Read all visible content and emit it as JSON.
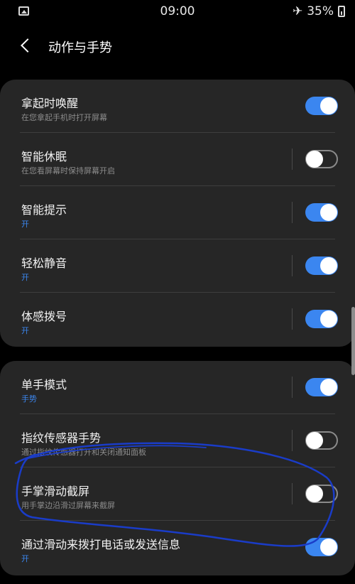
{
  "status_bar": {
    "time": "09:00",
    "battery": "35%",
    "icons": [
      "gallery-icon",
      "airplane-icon",
      "battery-icon"
    ]
  },
  "header": {
    "title": "动作与手势",
    "back_icon": "chevron-left-icon"
  },
  "sections": [
    {
      "items": [
        {
          "title": "拿起时唤醒",
          "subtitle": "在您拿起手机时打开屏幕",
          "toggle": "on"
        },
        {
          "title": "智能休眠",
          "subtitle": "在您看屏幕时保持屏幕开启",
          "toggle": "off"
        },
        {
          "title": "智能提示",
          "subtitle": "开",
          "toggle": "on"
        },
        {
          "title": "轻松静音",
          "subtitle": "开",
          "toggle": "on"
        },
        {
          "title": "体感拨号",
          "subtitle": "开",
          "toggle": "on"
        }
      ]
    },
    {
      "items": [
        {
          "title": "单手模式",
          "subtitle": "手势",
          "toggle": "on"
        },
        {
          "title": "指纹传感器手势",
          "subtitle": "通过指纹传感器打开和关闭通知面板",
          "toggle": "off"
        },
        {
          "title": "手掌滑动截屏",
          "subtitle": "用手掌边沿滑过屏幕来截屏",
          "toggle": "off"
        },
        {
          "title": "通过滑动来拨打电话或发送信息",
          "subtitle": "开",
          "toggle": "on"
        }
      ]
    }
  ],
  "colors": {
    "accent": "#3b86f0",
    "card_bg": "#262626",
    "annotation_ink": "#1a3cc8"
  }
}
